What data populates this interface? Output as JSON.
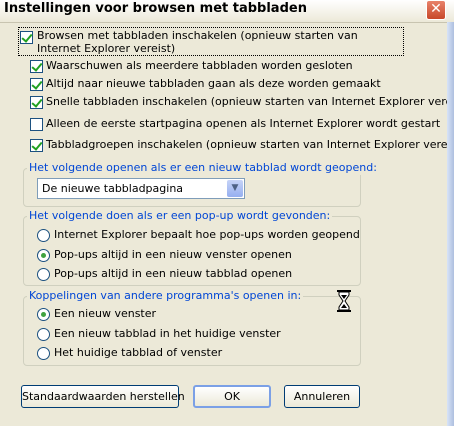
{
  "dialog": {
    "title": "Instellingen voor browsen met tabbladen",
    "close_glyph": "✕"
  },
  "main_checkbox": {
    "label": "Browsen met tabbladen inschakelen (opnieuw starten van Internet Explorer vereist)",
    "checked": true
  },
  "options": [
    {
      "label": "Waarschuwen als meerdere tabbladen worden gesloten",
      "checked": true
    },
    {
      "label": "Altijd naar nieuwe tabbladen gaan als deze worden gemaakt",
      "checked": true
    },
    {
      "label": "Snelle tabbladen inschakelen (opnieuw starten van Internet Explorer vereist)",
      "checked": true
    },
    {
      "label": "Alleen de eerste startpagina openen als Internet Explorer wordt gestart",
      "checked": false
    },
    {
      "label": "Tabbladgroepen inschakelen (opnieuw starten van Internet Explorer vereist)",
      "checked": true
    }
  ],
  "new_tab_group": {
    "title": "Het volgende openen als er een nieuw tabblad wordt geopend:",
    "selected": "De nieuwe tabbladpagina"
  },
  "popup_group": {
    "title": "Het volgende doen als er een pop-up wordt gevonden:",
    "options": [
      {
        "label": "Internet Explorer bepaalt hoe pop-ups worden geopend",
        "checked": false
      },
      {
        "label": "Pop-ups altijd in een nieuw venster openen",
        "checked": true
      },
      {
        "label": "Pop-ups altijd in een nieuw tabblad openen",
        "checked": false
      }
    ]
  },
  "links_group": {
    "title": "Koppelingen van andere programma's openen in:",
    "options": [
      {
        "label": "Een nieuw venster",
        "checked": true
      },
      {
        "label": "Een nieuw tabblad in het huidige venster",
        "checked": false
      },
      {
        "label": "Het huidige tabblad of venster",
        "checked": false
      }
    ]
  },
  "buttons": {
    "restore": "Standaardwaarden herstellen",
    "ok": "OK",
    "cancel": "Annuleren"
  },
  "icons": {
    "busy": "hourglass-icon"
  }
}
